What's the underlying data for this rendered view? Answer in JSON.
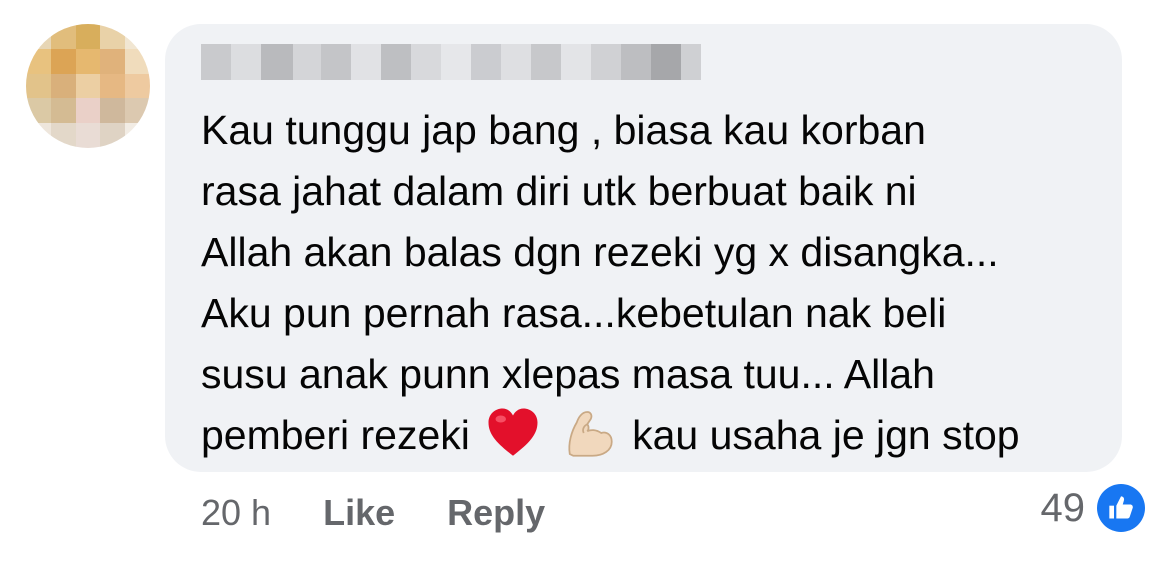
{
  "comment": {
    "lines": [
      "Kau tunggu jap bang , biasa kau korban",
      "rasa jahat dalam diri utk berbuat baik ni",
      "Allah akan balas dgn rezeki yg x disangka...",
      "Aku pun pernah rasa...kebetulan nak beli",
      "susu anak punn xlepas masa tuu... Allah"
    ],
    "last_line_before_emoji": "pemberi rezeki",
    "last_line_after_emoji": "kau usaha je jgn stop",
    "emojis": [
      "red-heart",
      "flexed-biceps"
    ]
  },
  "actions": {
    "time": "20 h",
    "like_label": "Like",
    "reply_label": "Reply"
  },
  "reactions": {
    "count": "49",
    "icon": "like-icon"
  },
  "colors": {
    "bubble": "#f0f2f5",
    "text": "#050505",
    "meta": "#65676b",
    "like_blue": "#1877f2"
  }
}
